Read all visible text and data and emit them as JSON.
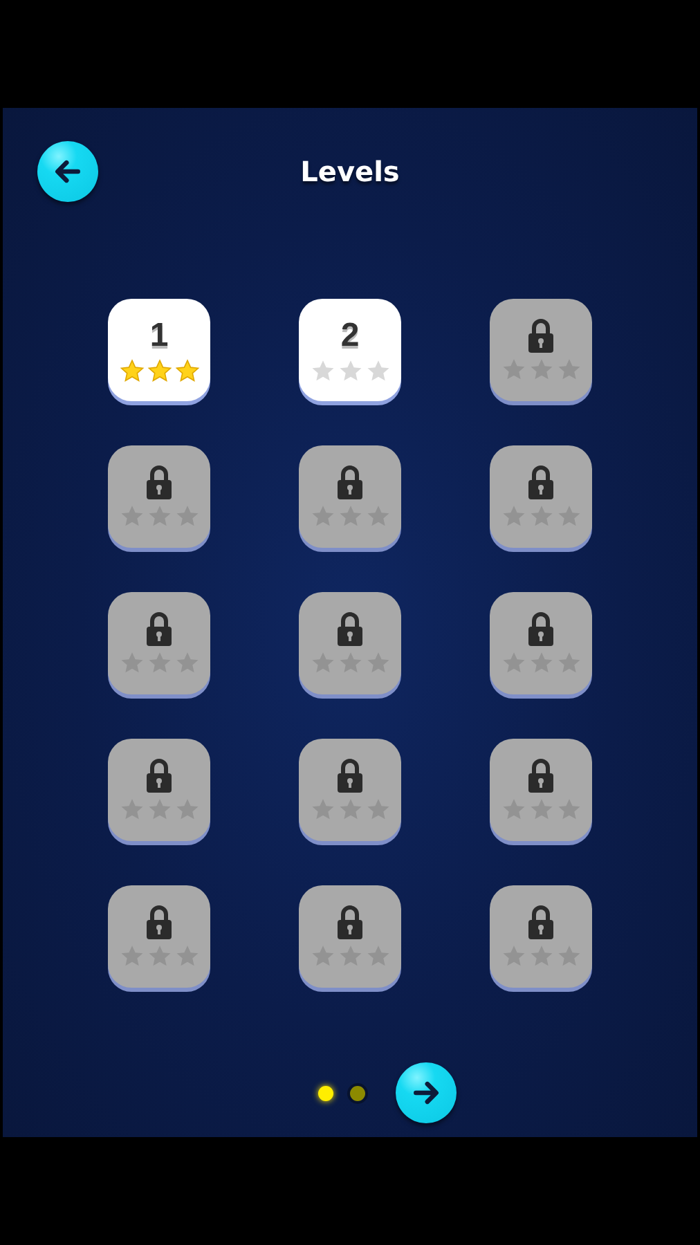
{
  "header": {
    "title": "Levels"
  },
  "levels": [
    {
      "kind": "unlocked",
      "label": "1",
      "stars": 3
    },
    {
      "kind": "unlocked",
      "label": "2",
      "stars": 0
    },
    {
      "kind": "locked",
      "stars": 0
    },
    {
      "kind": "locked",
      "stars": 0
    },
    {
      "kind": "locked",
      "stars": 0
    },
    {
      "kind": "locked",
      "stars": 0
    },
    {
      "kind": "locked",
      "stars": 0
    },
    {
      "kind": "locked",
      "stars": 0
    },
    {
      "kind": "locked",
      "stars": 0
    },
    {
      "kind": "locked",
      "stars": 0
    },
    {
      "kind": "locked",
      "stars": 0
    },
    {
      "kind": "locked",
      "stars": 0
    },
    {
      "kind": "locked",
      "stars": 0
    },
    {
      "kind": "locked",
      "stars": 0
    },
    {
      "kind": "locked",
      "stars": 0
    }
  ],
  "pages": [
    {
      "selected": true
    },
    {
      "selected": false
    }
  ]
}
